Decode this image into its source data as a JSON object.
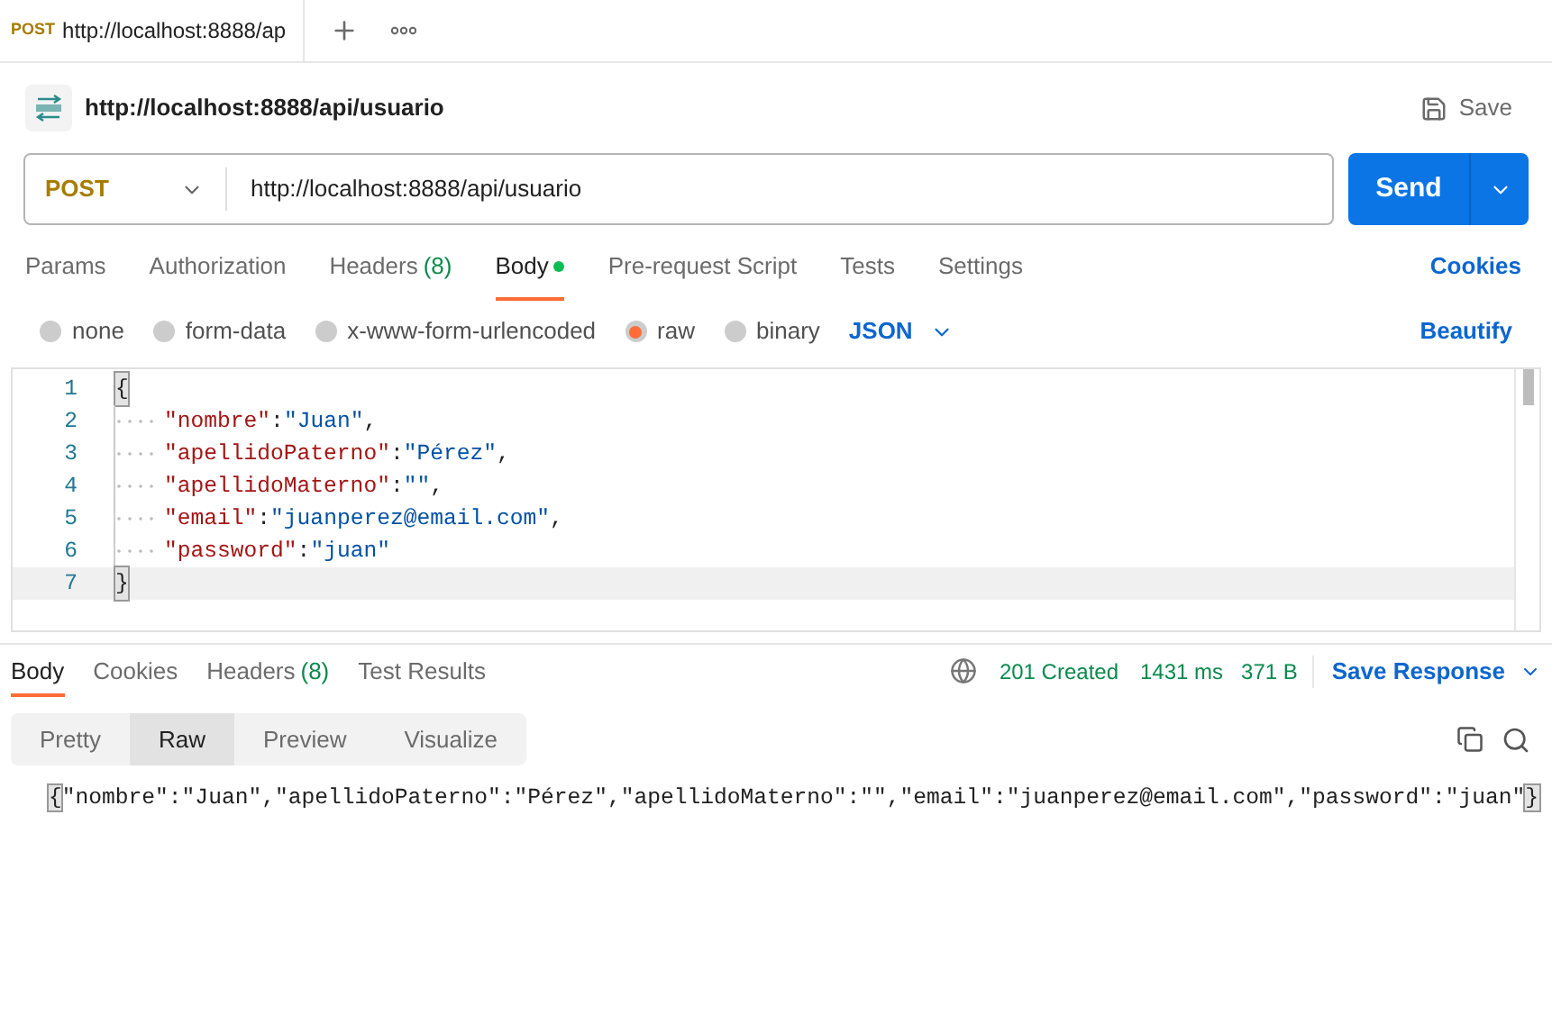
{
  "tab": {
    "method": "POST",
    "title": "http://localhost:8888/ap"
  },
  "request": {
    "name": "http://localhost:8888/api/usuario",
    "save": "Save",
    "method": "POST",
    "url": "http://localhost:8888/api/usuario",
    "send": "Send"
  },
  "request_tabs": [
    {
      "label": "Params",
      "selected": false,
      "dot": false
    },
    {
      "label": "Authorization",
      "selected": false,
      "dot": false
    },
    {
      "label": "Headers",
      "count": "(8)",
      "selected": false,
      "dot": false
    },
    {
      "label": "Body",
      "selected": true,
      "dot": true
    },
    {
      "label": "Pre-request Script",
      "selected": false,
      "dot": false
    },
    {
      "label": "Tests",
      "selected": false,
      "dot": false
    },
    {
      "label": "Settings",
      "selected": false,
      "dot": false
    }
  ],
  "cookies": "Cookies",
  "body_types": [
    {
      "label": "none",
      "selected": false
    },
    {
      "label": "form-data",
      "selected": false
    },
    {
      "label": "x-www-form-urlencoded",
      "selected": false
    },
    {
      "label": "raw",
      "selected": true
    },
    {
      "label": "binary",
      "selected": false
    }
  ],
  "format": "JSON",
  "beautify": "Beautify",
  "editor_lines": [
    {
      "number": "1",
      "indented": false,
      "parts": [
        {
          "kind": "brace",
          "text": "{"
        }
      ]
    },
    {
      "number": "2",
      "indented": true,
      "parts": [
        {
          "kind": "key",
          "text": "\"nombre\""
        },
        {
          "kind": "punct",
          "text": ":"
        },
        {
          "kind": "value",
          "text": "\"Juan\""
        },
        {
          "kind": "punct",
          "text": ","
        }
      ]
    },
    {
      "number": "3",
      "indented": true,
      "parts": [
        {
          "kind": "key",
          "text": "\"apellidoPaterno\""
        },
        {
          "kind": "punct",
          "text": ":"
        },
        {
          "kind": "value",
          "text": "\"Pérez\""
        },
        {
          "kind": "punct",
          "text": ","
        }
      ]
    },
    {
      "number": "4",
      "indented": true,
      "parts": [
        {
          "kind": "key",
          "text": "\"apellidoMaterno\""
        },
        {
          "kind": "punct",
          "text": ":"
        },
        {
          "kind": "value",
          "text": "\"\""
        },
        {
          "kind": "punct",
          "text": ","
        }
      ]
    },
    {
      "number": "5",
      "indented": true,
      "parts": [
        {
          "kind": "key",
          "text": "\"email\""
        },
        {
          "kind": "punct",
          "text": ":"
        },
        {
          "kind": "value",
          "text": "\"juanperez@email.com\""
        },
        {
          "kind": "punct",
          "text": ","
        }
      ]
    },
    {
      "number": "6",
      "indented": true,
      "parts": [
        {
          "kind": "key",
          "text": "\"password\""
        },
        {
          "kind": "punct",
          "text": ":"
        },
        {
          "kind": "value",
          "text": "\"juan\""
        }
      ]
    },
    {
      "number": "7",
      "indented": false,
      "parts": [
        {
          "kind": "brace",
          "text": "}"
        }
      ]
    }
  ],
  "response_tabs": [
    {
      "label": "Body",
      "selected": true
    },
    {
      "label": "Cookies",
      "selected": false
    },
    {
      "label": "Headers",
      "count": "(8)",
      "selected": false
    },
    {
      "label": "Test Results",
      "selected": false
    }
  ],
  "status": "201 Created",
  "time": "1431 ms",
  "size": "371 B",
  "save_response": "Save Response",
  "view_modes": [
    {
      "label": "Pretty",
      "selected": false
    },
    {
      "label": "Raw",
      "selected": true
    },
    {
      "label": "Preview",
      "selected": false
    },
    {
      "label": "Visualize",
      "selected": false
    }
  ],
  "response_parts": [
    {
      "kind": "brace",
      "text": "{"
    },
    {
      "kind": "text",
      "text": "\"nombre\":\"Juan\",\"apellidoPaterno\":\"Pérez\",\"apellidoMaterno\":\"\",\"email\":\"juanperez@email.com\",\"password\":\"juan\""
    },
    {
      "kind": "brace",
      "text": "}"
    }
  ]
}
